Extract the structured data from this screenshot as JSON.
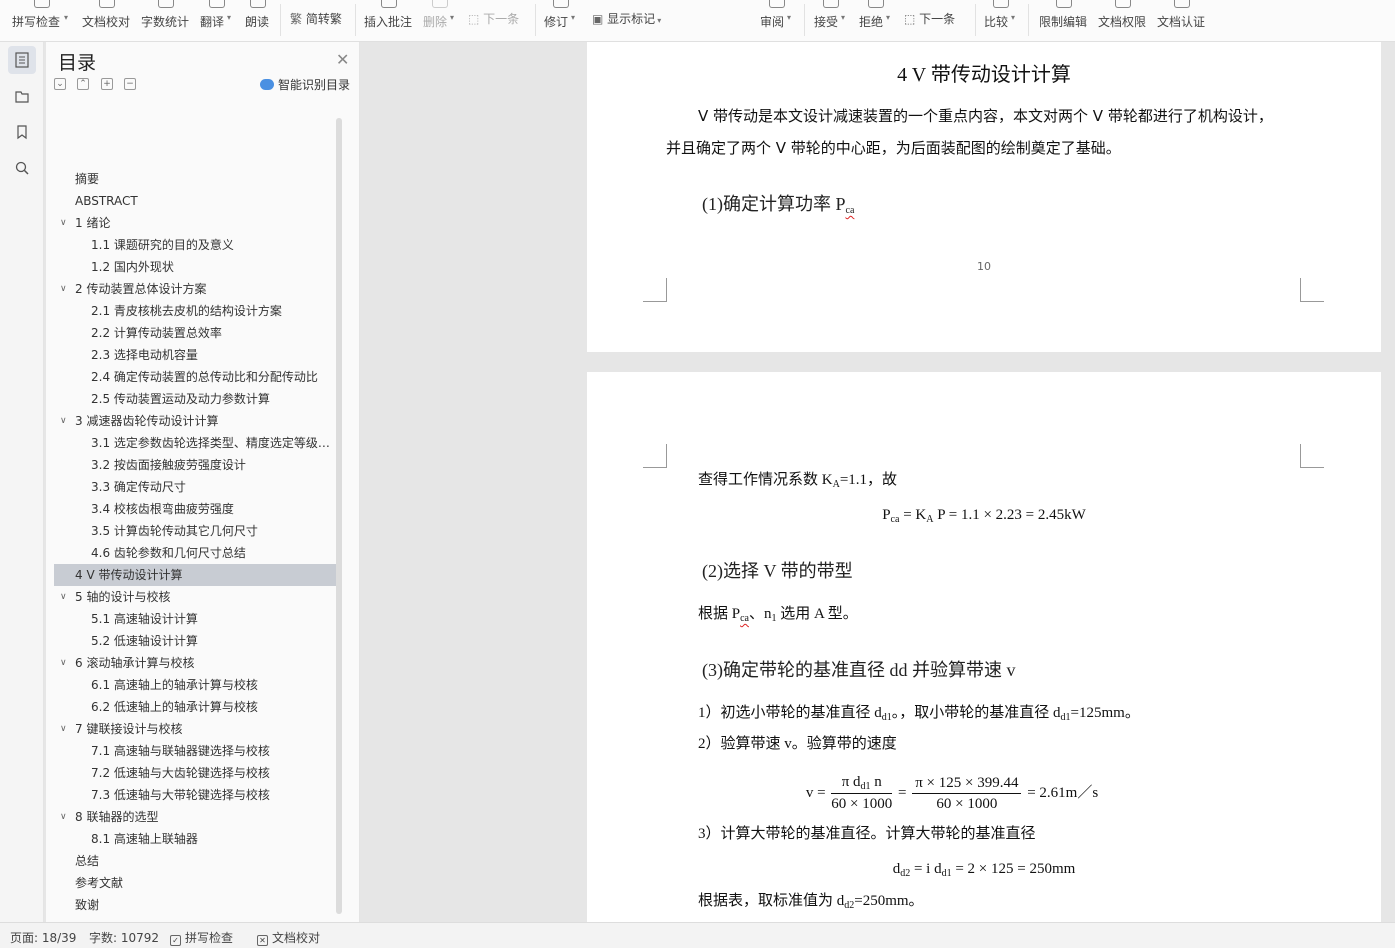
{
  "ribbon": {
    "spell_check": "拼写检查",
    "doc_proof": "文档校对",
    "word_count": "字数统计",
    "translate": "翻译",
    "read_aloud": "朗读",
    "trad_simp": "简转繁",
    "insert_comment": "插入批注",
    "delete": "删除",
    "next_comment": "下一条",
    "track_changes": "修订",
    "show_markup": "显示标记",
    "review": "审阅",
    "accept": "接受",
    "reject": "拒绝",
    "next_change": "下一条",
    "compare": "比较",
    "restrict_edit": "限制编辑",
    "doc_permission": "文档权限",
    "doc_certify": "文档认证"
  },
  "toc": {
    "title": "目录",
    "smart_toc": "智能识别目录",
    "items": [
      {
        "label": "摘要",
        "level": 1,
        "arrow": ""
      },
      {
        "label": "ABSTRACT",
        "level": 1,
        "arrow": ""
      },
      {
        "label": "1 绪论",
        "level": 1,
        "arrow": "v"
      },
      {
        "label": "1.1 课题研究的目的及意义",
        "level": 2,
        "arrow": ""
      },
      {
        "label": "1.2 国内外现状",
        "level": 2,
        "arrow": ""
      },
      {
        "label": "2   传动装置总体设计方案",
        "level": 1,
        "arrow": "v"
      },
      {
        "label": "2.1 青皮核桃去皮机的结构设计方案",
        "level": 2,
        "arrow": ""
      },
      {
        "label": "2.2 计算传动装置总效率",
        "level": 2,
        "arrow": ""
      },
      {
        "label": "2.3 选择电动机容量",
        "level": 2,
        "arrow": ""
      },
      {
        "label": "2.4 确定传动装置的总传动比和分配传动比",
        "level": 2,
        "arrow": ""
      },
      {
        "label": "2.5 传动装置运动及动力参数计算",
        "level": 2,
        "arrow": ""
      },
      {
        "label": "3   减速器齿轮传动设计计算",
        "level": 1,
        "arrow": "v"
      },
      {
        "label": "3.1 选定参数齿轮选择类型、精度选定等级 ...",
        "level": 2,
        "arrow": ""
      },
      {
        "label": "3.2 按齿面接触疲劳强度设计",
        "level": 2,
        "arrow": ""
      },
      {
        "label": "3.3 确定传动尺寸",
        "level": 2,
        "arrow": ""
      },
      {
        "label": "3.4 校核齿根弯曲疲劳强度",
        "level": 2,
        "arrow": ""
      },
      {
        "label": "3.5 计算齿轮传动其它几何尺寸",
        "level": 2,
        "arrow": ""
      },
      {
        "label": "4.6 齿轮参数和几何尺寸总结",
        "level": 2,
        "arrow": ""
      },
      {
        "label": "4   V 带传动设计计算",
        "level": 1,
        "arrow": "",
        "selected": true
      },
      {
        "label": "5   轴的设计与校核",
        "level": 1,
        "arrow": "v"
      },
      {
        "label": "5.1 高速轴设计计算",
        "level": 2,
        "arrow": ""
      },
      {
        "label": "5.2 低速轴设计计算",
        "level": 2,
        "arrow": ""
      },
      {
        "label": "6   滚动轴承计算与校核",
        "level": 1,
        "arrow": "v"
      },
      {
        "label": "6.1 高速轴上的轴承计算与校核",
        "level": 2,
        "arrow": ""
      },
      {
        "label": "6.2 低速轴上的轴承计算与校核",
        "level": 2,
        "arrow": ""
      },
      {
        "label": "7   键联接设计与校核",
        "level": 1,
        "arrow": "v"
      },
      {
        "label": "7.1 高速轴与联轴器键选择与校核",
        "level": 2,
        "arrow": ""
      },
      {
        "label": "7.2 低速轴与大齿轮键选择与校核",
        "level": 2,
        "arrow": ""
      },
      {
        "label": "7.3 低速轴与大带轮键选择与校核",
        "level": 2,
        "arrow": ""
      },
      {
        "label": "8   联轴器的选型",
        "level": 1,
        "arrow": "v"
      },
      {
        "label": "8.1 高速轴上联轴器",
        "level": 2,
        "arrow": ""
      },
      {
        "label": "总结",
        "level": 1,
        "arrow": ""
      },
      {
        "label": "参考文献",
        "level": 1,
        "arrow": ""
      },
      {
        "label": "致谢",
        "level": 1,
        "arrow": ""
      }
    ]
  },
  "doc": {
    "page1": {
      "heading": "4    V 带传动设计计算",
      "para1": "V 带传动是本文设计减速装置的一个重点内容，本文对两个 V 带轮都进行了机构设计，",
      "para2": "并且确定了两个 V 带轮的中心距，为后面装配图的绘制奠定了基础。",
      "sub1_text": "(1)确定计算功率 P",
      "sub1_subscript": "ca",
      "page_number": "10"
    },
    "page2": {
      "line1_a": "查得工作情况系数 K",
      "line1_sub": "A",
      "line1_b": "=1.1，故",
      "f1_a": "P",
      "f1_sub1": "ca",
      "f1_b": " = K",
      "f1_sub2": "A",
      "f1_c": " P = 1.1 × 2.23 = 2.45kW",
      "sub2": "(2)选择 V 带的带型",
      "line2_a": "根据 P",
      "line2_sub": "ca",
      "line2_b": "、n",
      "line2_sub2": "1",
      "line2_c": " 选用 A 型。",
      "sub3": "(3)确定带轮的基准直径 dd 并验算带速 v",
      "step1_a": "1）初选小带轮的基准直径 d",
      "step1_sub": "d1",
      "step1_b": "。，取小带轮的基准直径 d",
      "step1_sub2": "d1",
      "step1_c": "=125mm。",
      "step2": "2）验算带速 v。验算带的速度",
      "f2_lhs": "v = ",
      "f2_num1_a": "π d",
      "f2_num1_sub": "d1",
      "f2_num1_b": " n",
      "f2_den1": "60 × 1000",
      "f2_eq": " = ",
      "f2_num2": "π × 125 × 399.44",
      "f2_den2": "60 × 1000",
      "f2_rhs": " = 2.61m／s",
      "step3": "3）计算大带轮的基准直径。计算大带轮的基准直径",
      "f3_a": "d",
      "f3_sub1": "d2",
      "f3_b": " = i d",
      "f3_sub2": "d1",
      "f3_c": " = 2 × 125 = 250mm",
      "line_last_a": "根据表，取标准值为 d",
      "line_last_sub": "d2",
      "line_last_b": "=250mm。"
    }
  },
  "status": {
    "page": "页面: 18/39",
    "words": "字数: 10792",
    "spell": "拼写检查",
    "proof": "文档校对"
  }
}
